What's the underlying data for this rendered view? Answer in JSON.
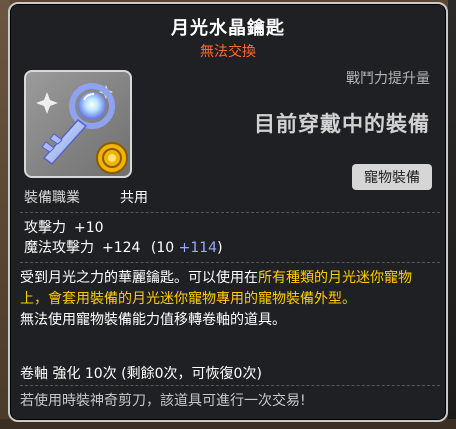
{
  "item": {
    "name": "月光水晶鑰匙",
    "trade_status": "無法交換",
    "icon": "crystal-key-icon",
    "power_label": "戰鬥力提升量",
    "equipped_label": "目前穿戴中的裝備",
    "category_badge": "寵物裝備",
    "job_label": "裝備職業",
    "job_value": "共用"
  },
  "stats": {
    "attack_label": "攻擊力",
    "attack_value": "+10",
    "magic_label": "魔法攻擊力",
    "magic_value": "+124",
    "magic_base_open": "(10",
    "magic_bonus": "+114",
    "magic_close": ")"
  },
  "description": {
    "part1": "受到月光之力的華麗鑰匙。可以使用在",
    "highlight1": "所有種類的月光迷你寵物上，會套用裝備的月光迷你寵物專用的寵物裝備外型。",
    "line2": "無法使用寵物裝備能力值移轉卷軸的道具。"
  },
  "upgrade": {
    "text": "卷軸 強化 10次 (剩餘0次，可恢復0次)"
  },
  "notice": {
    "text": "若使用時裝神奇剪刀，該道具可進行一次交易!"
  },
  "colors": {
    "title": "#ffffff",
    "untradeable": "#ff6a2a",
    "highlight": "#ffcc00",
    "bonus": "#9aa8ff"
  }
}
